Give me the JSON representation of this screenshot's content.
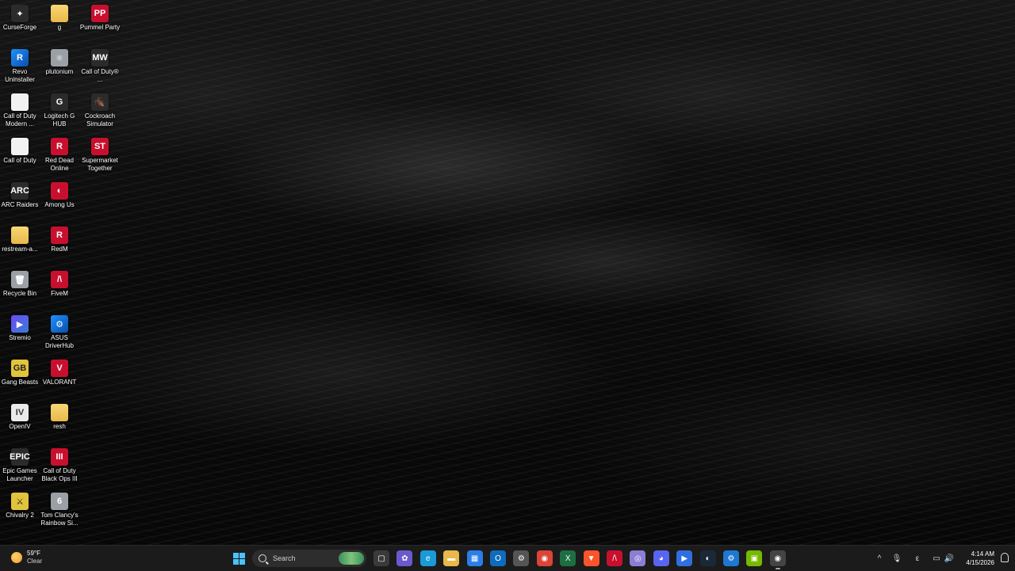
{
  "desktop_icons": [
    {
      "label": "CurseForge",
      "icon": "curseforge-icon",
      "glyph": "✦"
    },
    {
      "label": "g",
      "icon": "folder-icon",
      "glyph": ""
    },
    {
      "label": "Pummel Party",
      "icon": "pummel-party-icon",
      "glyph": "PP"
    },
    {
      "label": "Revo Uninstaller",
      "icon": "revo-uninstaller-icon",
      "glyph": "R"
    },
    {
      "label": "plutonium",
      "icon": "plutonium-icon",
      "glyph": "⚛"
    },
    {
      "label": "Call of Duty® ...",
      "icon": "call-of-duty-icon",
      "glyph": "MW"
    },
    {
      "label": "Call of Duty Modern ...",
      "icon": "shortcut-file-icon",
      "glyph": ""
    },
    {
      "label": "Logitech G HUB",
      "icon": "logitech-g-icon",
      "glyph": "G"
    },
    {
      "label": "Cockroach Simulator",
      "icon": "cockroach-simulator-icon",
      "glyph": "🪳"
    },
    {
      "label": "Call of Duty",
      "icon": "shortcut-file-icon",
      "glyph": ""
    },
    {
      "label": "Red Dead Online",
      "icon": "red-dead-online-icon",
      "glyph": "R"
    },
    {
      "label": "Supermarket Together",
      "icon": "supermarket-together-icon",
      "glyph": "ST"
    },
    {
      "label": "ARC Raiders",
      "icon": "arc-raiders-icon",
      "glyph": "ARC"
    },
    {
      "label": "Among Us",
      "icon": "among-us-icon",
      "glyph": "◐"
    },
    {
      "label": "restream-a...",
      "icon": "folder-icon",
      "glyph": ""
    },
    {
      "label": "RedM",
      "icon": "redm-icon",
      "glyph": "R"
    },
    {
      "label": "Recycle Bin",
      "icon": "recycle-bin-icon",
      "glyph": "🗑"
    },
    {
      "label": "FiveM",
      "icon": "fivem-icon",
      "glyph": "/\\"
    },
    {
      "label": "Stremio",
      "icon": "stremio-icon",
      "glyph": "▶"
    },
    {
      "label": "ASUS DriverHub",
      "icon": "asus-driverhub-icon",
      "glyph": "⚙"
    },
    {
      "label": "Gang Beasts",
      "icon": "gang-beasts-icon",
      "glyph": "GB"
    },
    {
      "label": "VALORANT",
      "icon": "valorant-icon",
      "glyph": "V"
    },
    {
      "label": "OpenIV",
      "icon": "openiv-icon",
      "glyph": "IV"
    },
    {
      "label": "resh",
      "icon": "folder-icon",
      "glyph": ""
    },
    {
      "label": "Epic Games Launcher",
      "icon": "epic-games-icon",
      "glyph": "EPIC"
    },
    {
      "label": "Call of Duty Black Ops III",
      "icon": "black-ops-3-icon",
      "glyph": "III"
    },
    {
      "label": "Chivalry 2",
      "icon": "chivalry-2-icon",
      "glyph": "⚔"
    },
    {
      "label": "Tom Clancy's Rainbow Si...",
      "icon": "rainbow-six-icon",
      "glyph": "6"
    }
  ],
  "taskbar": {
    "weather": {
      "temp": "59°F",
      "condition": "Clear"
    },
    "search_label": "Search",
    "apps": [
      {
        "name": "task-view",
        "glyph": "▢"
      },
      {
        "name": "copilot",
        "glyph": "✿"
      },
      {
        "name": "edge",
        "glyph": "e"
      },
      {
        "name": "file-explorer",
        "glyph": "▬"
      },
      {
        "name": "microsoft-store",
        "glyph": "▦"
      },
      {
        "name": "outlook",
        "glyph": "O"
      },
      {
        "name": "settings",
        "glyph": "⚙"
      },
      {
        "name": "chrome",
        "glyph": "◉"
      },
      {
        "name": "excel",
        "glyph": "X"
      },
      {
        "name": "brave",
        "glyph": "▼"
      },
      {
        "name": "fivem-taskbar",
        "glyph": "/\\"
      },
      {
        "name": "app-circle",
        "glyph": "◎"
      },
      {
        "name": "discord",
        "glyph": "◕"
      },
      {
        "name": "app-blue",
        "glyph": "▶"
      },
      {
        "name": "steam",
        "glyph": "◐"
      },
      {
        "name": "asus-app",
        "glyph": "⚙"
      },
      {
        "name": "nvidia",
        "glyph": "▣"
      },
      {
        "name": "obs-active",
        "glyph": "◉"
      }
    ],
    "tray": {
      "chevron": "^",
      "mic": "🎙",
      "lang": "ε",
      "network": "▭",
      "volume": "🔊",
      "battery": "▯"
    },
    "clock": {
      "time": "4:14 AM",
      "date": "4/15/2026"
    }
  }
}
